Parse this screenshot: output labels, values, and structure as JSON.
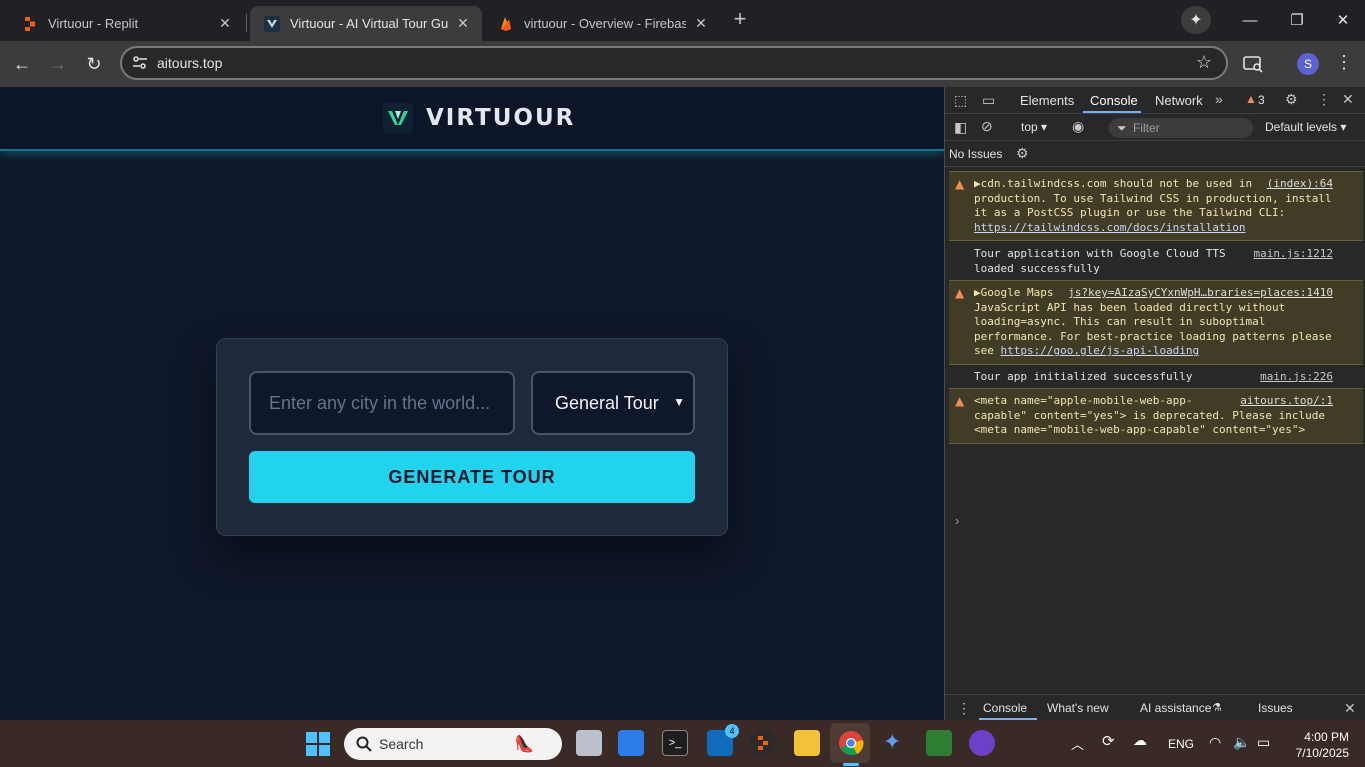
{
  "browser": {
    "tabs": [
      {
        "title": "Virtuour - Replit",
        "active": false
      },
      {
        "title": "Virtuour - AI Virtual Tour Guide",
        "active": true
      },
      {
        "title": "virtuour - Overview - Firebase c",
        "active": false
      }
    ],
    "url": "aitours.top",
    "profile_initial": "S"
  },
  "page": {
    "brand_name": "VIRTUOUR",
    "city_input_placeholder": "Enter any city in the world...",
    "tour_type_selected": "General Tour",
    "generate_button": "GENERATE TOUR",
    "accent": "#22d3ee"
  },
  "devtools": {
    "tabs": [
      "Elements",
      "Console",
      "Network"
    ],
    "active_tab": "Console",
    "warning_count": "3",
    "context": "top",
    "filter_placeholder": "Filter",
    "levels": "Default levels",
    "issues_label": "No Issues",
    "messages": [
      {
        "level": "warn",
        "expandable": true,
        "text": "cdn.tailwindcss.com should not be used in production. To use Tailwind CSS in production, install it as a PostCSS plugin or use the Tailwind CLI: ",
        "link": "https://tailwindcss.com/docs/installation",
        "source": "(index):64"
      },
      {
        "level": "info",
        "expandable": false,
        "text": "Tour application with Google Cloud TTS loaded successfully",
        "link": "",
        "source": "main.js:1212"
      },
      {
        "level": "warn",
        "expandable": true,
        "text": "Google Maps JavaScript API has been loaded directly without loading=async. This can result in suboptimal performance. For best-practice loading patterns please see ",
        "link": "https://goo.gle/js-api-loading",
        "source": "js?key=AIzaSyCYxnWpH…braries=places:1410"
      },
      {
        "level": "info",
        "expandable": false,
        "text": "Tour app initialized successfully",
        "link": "",
        "source": "main.js:226"
      },
      {
        "level": "warn",
        "expandable": false,
        "text": "<meta name=\"apple-mobile-web-app-capable\" content=\"yes\"> is deprecated. Please include <meta name=\"mobile-web-app-capable\" content=\"yes\">",
        "link": "",
        "source": "aitours.top/:1"
      }
    ],
    "drawer_tabs": [
      "Console",
      "What's new",
      "AI assistance",
      "Issues"
    ]
  },
  "taskbar": {
    "search_label": "Search",
    "language": "ENG",
    "time": "4:00 PM",
    "date": "7/10/2025",
    "mail_badge": "4"
  }
}
